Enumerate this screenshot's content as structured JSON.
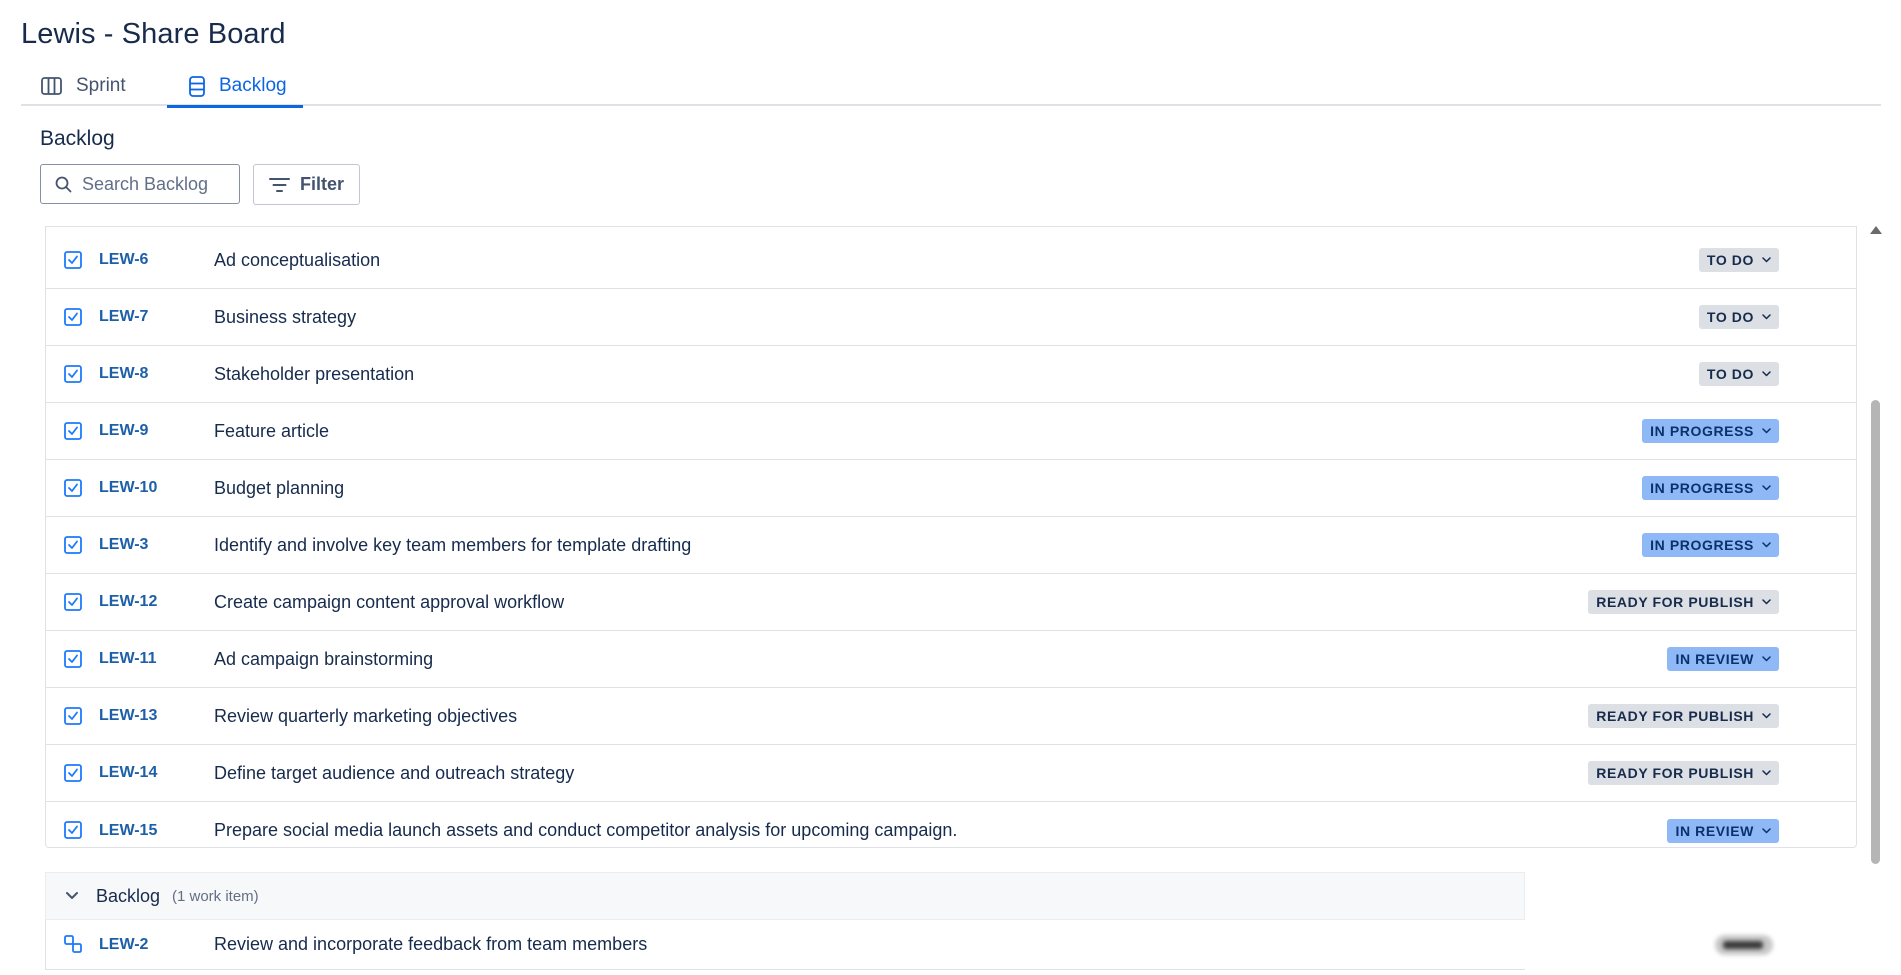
{
  "page": {
    "title": "Lewis - Share Board"
  },
  "tabs": [
    {
      "label": "Sprint",
      "icon": "columns-board-icon",
      "active": false
    },
    {
      "label": "Backlog",
      "icon": "backlog-list-icon",
      "active": true
    }
  ],
  "section": {
    "heading": "Backlog"
  },
  "search": {
    "placeholder": "Search Backlog",
    "value": ""
  },
  "filter": {
    "label": "Filter"
  },
  "colors": {
    "accent": "#0c66e4",
    "key_link": "#1d5fa8",
    "todo_bg": "#dcdfe4",
    "progress_bg": "#8fb8f6"
  },
  "items": [
    {
      "key": "LEW-6",
      "summary": "Ad conceptualisation",
      "status": "TO DO",
      "status_type": "todo"
    },
    {
      "key": "LEW-7",
      "summary": "Business strategy",
      "status": "TO DO",
      "status_type": "todo"
    },
    {
      "key": "LEW-8",
      "summary": "Stakeholder presentation",
      "status": "TO DO",
      "status_type": "todo"
    },
    {
      "key": "LEW-9",
      "summary": "Feature article",
      "status": "IN PROGRESS",
      "status_type": "inprogress"
    },
    {
      "key": "LEW-10",
      "summary": "Budget planning",
      "status": "IN PROGRESS",
      "status_type": "inprogress"
    },
    {
      "key": "LEW-3",
      "summary": "Identify and involve key team members for template drafting",
      "status": "IN PROGRESS",
      "status_type": "inprogress"
    },
    {
      "key": "LEW-12",
      "summary": "Create campaign content approval workflow",
      "status": "READY FOR PUBLISH",
      "status_type": "ready"
    },
    {
      "key": "LEW-11",
      "summary": "Ad campaign brainstorming",
      "status": "IN REVIEW",
      "status_type": "inreview"
    },
    {
      "key": "LEW-13",
      "summary": "Review quarterly marketing objectives",
      "status": "READY FOR PUBLISH",
      "status_type": "ready"
    },
    {
      "key": "LEW-14",
      "summary": "Define target audience and outreach strategy",
      "status": "READY FOR PUBLISH",
      "status_type": "ready"
    },
    {
      "key": "LEW-15",
      "summary": "Prepare social media launch assets and conduct competitor analysis for upcoming campaign.",
      "status": "IN REVIEW",
      "status_type": "inreview"
    }
  ],
  "backlog": {
    "title": "Backlog",
    "count": "(1 work item)",
    "items": [
      {
        "key": "LEW-2",
        "summary": "Review and incorporate feedback from team members",
        "icon": "subtask-icon"
      }
    ]
  }
}
